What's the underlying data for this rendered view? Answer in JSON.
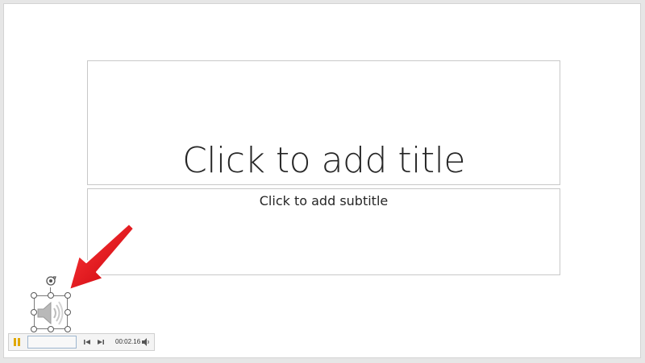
{
  "slide": {
    "title_placeholder": "Click to add title",
    "subtitle_placeholder": "Click to add subtitle"
  },
  "audio_player": {
    "time": "00:02.16",
    "icons": {
      "play_pause": "pause-icon",
      "back": "step-back-icon",
      "forward": "step-forward-icon",
      "volume": "speaker-icon"
    }
  },
  "audio_object": {
    "icon": "speaker-icon"
  },
  "annotation": {
    "arrow_color": "#e8101c"
  }
}
